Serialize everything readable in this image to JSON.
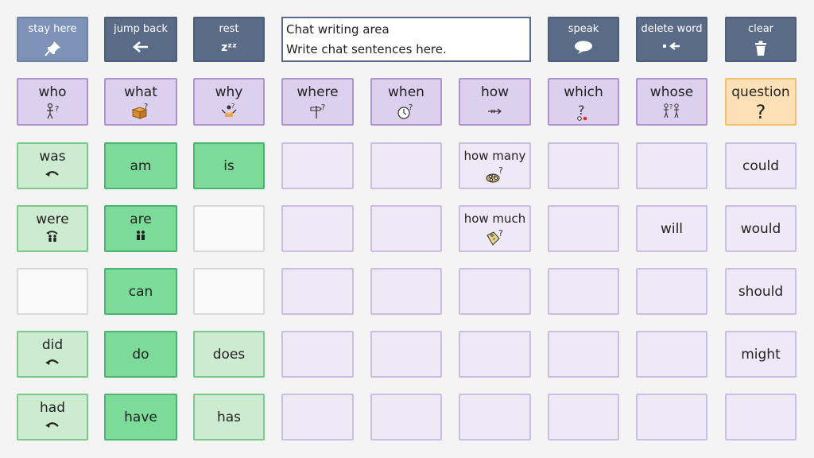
{
  "toolbar": {
    "stay_here": "stay here",
    "jump_back": "jump back",
    "rest": "rest",
    "speak": "speak",
    "delete_word": "delete word",
    "clear": "clear",
    "rest_glyph": "zᶻᶻ"
  },
  "chat": {
    "line1": "Chat writing area",
    "line2": "Write chat sentences here."
  },
  "questions": {
    "who": "who",
    "what": "what",
    "why": "why",
    "where": "where",
    "when": "when",
    "how": "how",
    "which": "which",
    "whose": "whose",
    "question": "question",
    "question_mark": "?"
  },
  "grid": {
    "was": "was",
    "am": "am",
    "is": "is",
    "how_many": "how many",
    "could": "could",
    "were": "were",
    "are": "are",
    "how_much": "how much",
    "will": "will",
    "would": "would",
    "can": "can",
    "should": "should",
    "did": "did",
    "do": "do",
    "does": "does",
    "might": "might",
    "had": "had",
    "have": "have",
    "has": "has"
  },
  "colors": {
    "toolbar": "#5a6b88",
    "toolbar_light": "#7e92b8",
    "question_bg": "#dcd0ee",
    "question_yellow": "#fde0b6",
    "verb_light_green": "#cdebd0",
    "verb_green": "#7ddb99",
    "lavender": "#ede9f7"
  }
}
